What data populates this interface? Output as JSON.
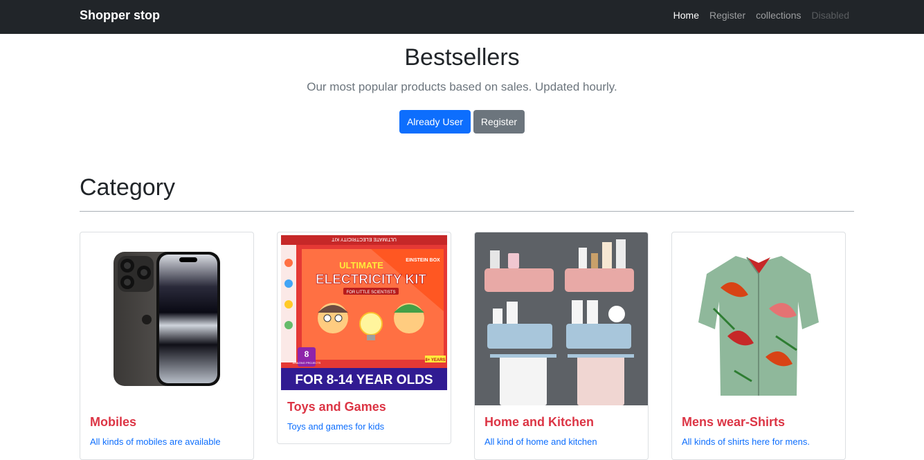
{
  "navbar": {
    "brand": "Shopper stop",
    "links": [
      "Home",
      "Register",
      "collections",
      "Disabled"
    ]
  },
  "hero": {
    "title": "Bestsellers",
    "subtitle": "Our most popular products based on sales. Updated hourly.",
    "primary_button": "Already User",
    "secondary_button": "Register"
  },
  "category": {
    "heading": "Category",
    "cards": [
      {
        "title": "Mobiles",
        "text": "All kinds of mobiles are available"
      },
      {
        "title": "Toys and Games",
        "text": "Toys and games for kids"
      },
      {
        "title": "Home and Kitchen",
        "text": "All kind of home and kitchen"
      },
      {
        "title": "Mens wear-Shirts",
        "text": "All kinds of shirts here for mens."
      }
    ],
    "box_art": {
      "top_label": "ULTIMATE ELECTRICITY KIT",
      "headline_1": "ULTIMATE",
      "headline_2": "ELECTRICITY KIT",
      "tagline": "FOR LITTLE SCIENTISTS",
      "brand": "EINSTEIN BOX",
      "badge_number": "8",
      "badge_text": "AMAZING PROJECTS",
      "age_badge": "8+ YEARS",
      "footer": "FOR 8-14 YEAR OLDS"
    }
  },
  "colors": {
    "navbar_bg": "#212529",
    "primary": "#0d6efd",
    "secondary": "#6c757d",
    "card_title": "#dc3545"
  }
}
